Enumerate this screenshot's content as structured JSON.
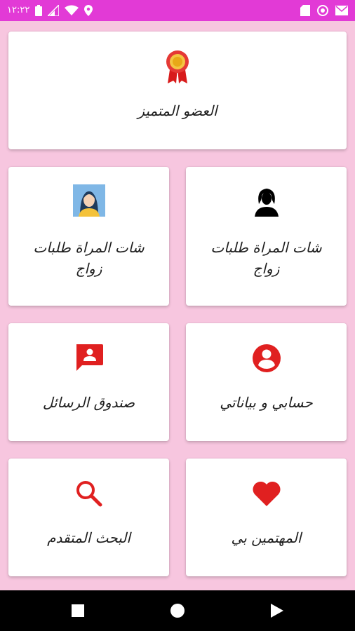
{
  "status_bar": {
    "time": "١٢:٢٢",
    "bg_color": "#e23ad6",
    "left_icons": [
      "battery-icon",
      "signal-icon",
      "wifi-icon",
      "location-icon"
    ],
    "right_icons": [
      "sd-card-icon",
      "sync-icon",
      "mail-icon"
    ]
  },
  "accent_color": "#e02020",
  "background_color": "#f7c6df",
  "cards": {
    "featured": {
      "label": "العضو المتميز",
      "icon": "award-ribbon-icon"
    },
    "chat_women_photo": {
      "label": "شات المراة طلبات زواج",
      "icon": "woman-portrait-icon"
    },
    "chat_women_silhouette": {
      "label": "شات المراة طلبات زواج",
      "icon": "woman-silhouette-icon"
    },
    "messages": {
      "label": "صندوق الرسائل",
      "icon": "message-box-icon"
    },
    "account": {
      "label": "حسابي و بياناتي",
      "icon": "account-circle-icon"
    },
    "advanced_search": {
      "label": "البحث المتقدم",
      "icon": "search-icon"
    },
    "interested": {
      "label": "المهتمين بي",
      "icon": "heart-icon"
    }
  },
  "nav_bar": {
    "buttons": [
      "recent-apps-icon",
      "home-icon",
      "back-icon"
    ]
  }
}
